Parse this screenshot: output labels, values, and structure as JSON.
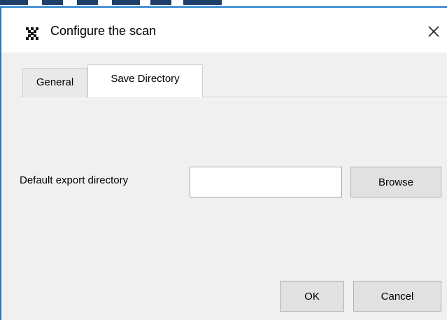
{
  "window": {
    "title": "Configure the scan",
    "app_icon": "scan-app-icon",
    "close_icon": "close-icon"
  },
  "tabs": [
    {
      "label": "General",
      "selected": false
    },
    {
      "label": "Save Directory",
      "selected": true
    }
  ],
  "save_directory": {
    "export_label": "Default export directory",
    "export_value": "",
    "browse_label": "Browse"
  },
  "footer": {
    "ok_label": "OK",
    "cancel_label": "Cancel"
  },
  "colors": {
    "window_border": "#1979ca",
    "dialog_bg": "#f0f0f0",
    "button_bg": "#e1e1e1"
  }
}
